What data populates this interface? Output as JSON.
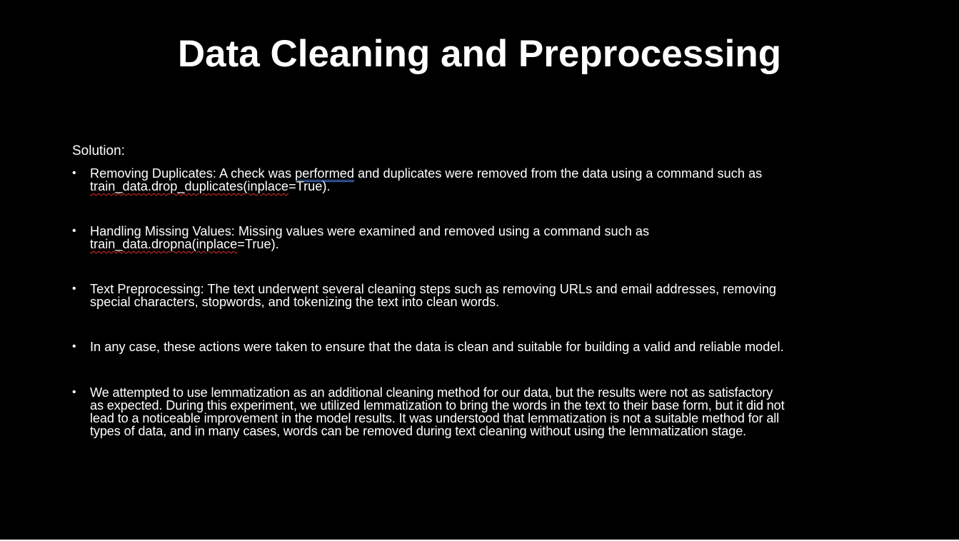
{
  "slide": {
    "title": "Data Cleaning and Preprocessing",
    "solution_label": "Solution:",
    "bullet_symbol": "•",
    "bullets": [
      {
        "line1_before": "Removing Duplicates: A check was ",
        "line1_marked": "performed",
        "line1_after": " and duplicates were removed from the data using a command such as",
        "line2_marked": "train_data.drop_duplicates(inplace",
        "line2_after": "=True)."
      },
      {
        "line1": "Handling Missing Values: Missing values were examined and removed using a command such as",
        "line2_marked": "train_data.dropna(inplace",
        "line2_after": "=True)."
      },
      {
        "line1": "Text Preprocessing: The text underwent several cleaning steps such as removing URLs and email addresses, removing",
        "line2": "special characters, stopwords, and tokenizing the text into clean words."
      },
      {
        "line1": "In any case, these actions were taken to ensure that the data is clean and suitable for building a valid and reliable model."
      },
      {
        "line1": "We attempted to use lemmatization as an additional cleaning method for our data, but the results were not as satisfactory",
        "line2": "as expected. During this experiment, we utilized lemmatization to bring the words in the text to their base form, but it did not",
        "line3": "lead to a noticeable improvement in the model results. It was understood that lemmatization is not a suitable method for all",
        "line4": "types of data, and in many cases, words can be removed during text cleaning without using the lemmatization stage."
      }
    ]
  },
  "colors": {
    "background": "#000000",
    "text": "#ffffff",
    "spellcheck_underline": "#e03131",
    "grammar_underline": "#4a7ee8"
  }
}
